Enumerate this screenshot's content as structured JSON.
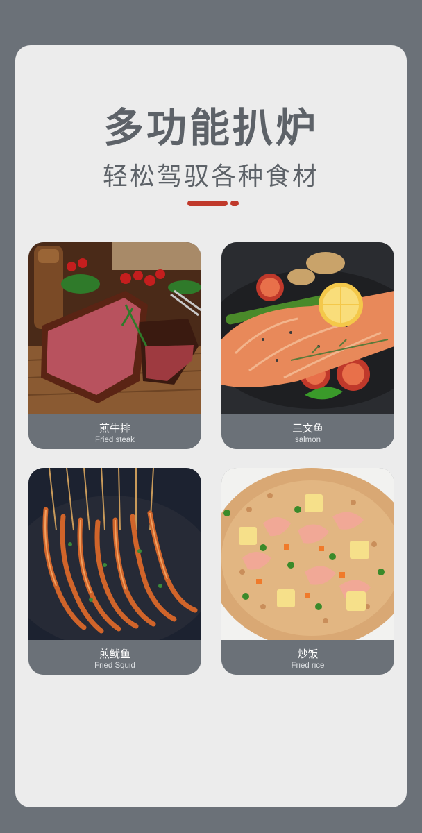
{
  "header": {
    "title": "多功能扒炉",
    "subtitle": "轻松驾驭各种食材"
  },
  "colors": {
    "background": "#6b7178",
    "panel": "#ececec",
    "heading": "#5d6268",
    "accent": "#c0392b"
  },
  "foods": [
    {
      "name_zh": "煎牛排",
      "name_en": "Fried steak",
      "image": "steak-photo"
    },
    {
      "name_zh": "三文鱼",
      "name_en": "salmon",
      "image": "salmon-photo"
    },
    {
      "name_zh": "煎鱿鱼",
      "name_en": "Fried Squid",
      "image": "squid-skewers-photo"
    },
    {
      "name_zh": "炒饭",
      "name_en": "Fried rice",
      "image": "fried-rice-photo"
    }
  ]
}
